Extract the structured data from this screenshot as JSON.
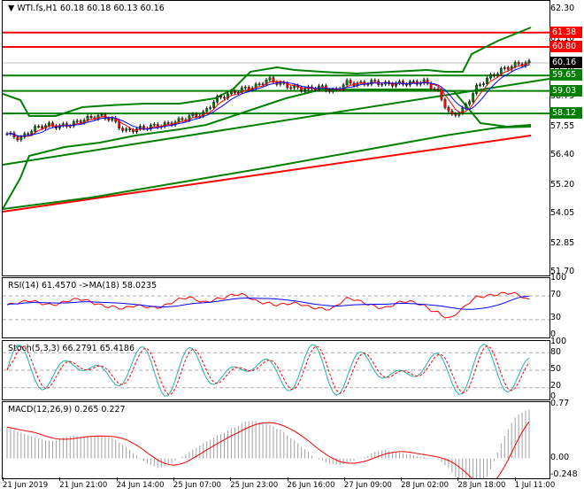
{
  "header": {
    "symbol": "WTI.fs,H1",
    "ohlc": "60.18 60.18 60.13 60.16"
  },
  "price_axis": [
    "62.30",
    "61.10",
    "59.90",
    "58.75",
    "57.55",
    "56.40",
    "55.20",
    "54.05",
    "52.85",
    "51.70"
  ],
  "price_range": [
    51.7,
    62.3
  ],
  "current_price": "60.16",
  "levels": [
    {
      "value": "61.38",
      "color": "#ff0000"
    },
    {
      "value": "60.80",
      "color": "#ff0000"
    },
    {
      "value": "59.65",
      "color": "#008000"
    },
    {
      "value": "59.03",
      "color": "#008000"
    },
    {
      "value": "58.12",
      "color": "#008000"
    }
  ],
  "close_series": [
    57.3,
    57.1,
    57.5,
    57.66,
    57.6,
    57.7,
    57.9,
    58.02,
    57.9,
    57.4,
    57.5,
    57.6,
    57.66,
    57.8,
    58.0,
    58.1,
    58.7,
    58.9,
    59.1,
    59.2,
    59.5,
    59.3,
    59.16,
    59.1,
    59.2,
    59.0,
    59.37,
    59.3,
    59.4,
    59.3,
    59.33,
    59.35,
    59.4,
    59.0,
    58.0,
    58.3,
    59.2,
    59.6,
    59.9,
    60.1,
    60.16
  ],
  "rsi": {
    "label": "RSI(14) 61.4570  ->MA(18) 58.0235",
    "axis": [
      "100",
      "70",
      "30",
      "0"
    ]
  },
  "stoch": {
    "label": "Stoch(5,3,3) 66.2791 65.4186",
    "axis": [
      "100",
      "80",
      "50",
      "20",
      "0"
    ]
  },
  "macd": {
    "label": "MACD(12,26,9) 0.265 0.227",
    "axis": [
      "0.77",
      "0.00",
      "-0.248"
    ]
  },
  "time_axis": [
    "21 Jun 2019",
    "21 Jun 21:00",
    "24 Jun 14:00",
    "25 Jun 07:00",
    "25 Jun 23:00",
    "26 Jun 16:00",
    "27 Jun 09:00",
    "28 Jun 02:00",
    "28 Jun 18:00",
    "1 Jul 11:00"
  ]
}
